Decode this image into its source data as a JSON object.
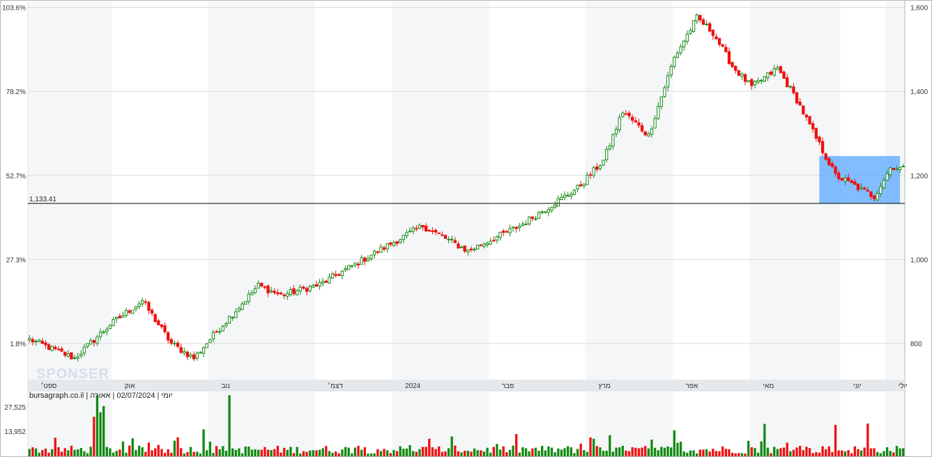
{
  "chart_data": {
    "type": "candlestick",
    "price_axis_right": {
      "ticks": [
        "1,600",
        "1,400",
        "1,200",
        "1,000",
        "800"
      ],
      "values": [
        1600,
        1400,
        1200,
        1000,
        800
      ],
      "range": [
        714,
        1614
      ]
    },
    "percent_axis_left": {
      "ticks": [
        "103.6%",
        "78.2%",
        "52.7%",
        "27.3%",
        "1.8%"
      ]
    },
    "reference_line": {
      "label": "1,133.41",
      "value": 1133.41
    },
    "months": [
      "ספט׳",
      "אוק",
      "נוב",
      "דצמ׳",
      "2024",
      "פבר",
      "מרץ",
      "אפר",
      "מאי",
      "יוני",
      "יולי"
    ],
    "highlight_range": {
      "start_index": 246,
      "end_index": 269,
      "price_low": 1134,
      "price_high": 1246
    },
    "volume_axis": {
      "ticks": [
        "27,525",
        "13,952"
      ],
      "values": [
        27525,
        13952
      ]
    },
    "key_points": [
      {
        "index": 0,
        "price": 810
      },
      {
        "index": 14,
        "price": 765
      },
      {
        "index": 25,
        "price": 845
      },
      {
        "index": 35,
        "price": 902
      },
      {
        "index": 44,
        "price": 800
      },
      {
        "index": 51,
        "price": 765
      },
      {
        "index": 58,
        "price": 828
      },
      {
        "index": 71,
        "price": 938
      },
      {
        "index": 78,
        "price": 915
      },
      {
        "index": 90,
        "price": 940
      },
      {
        "index": 108,
        "price": 1020
      },
      {
        "index": 122,
        "price": 1080
      },
      {
        "index": 136,
        "price": 1020
      },
      {
        "index": 152,
        "price": 1080
      },
      {
        "index": 170,
        "price": 1170
      },
      {
        "index": 178,
        "price": 1235
      },
      {
        "index": 184,
        "price": 1352
      },
      {
        "index": 192,
        "price": 1295
      },
      {
        "index": 200,
        "price": 1480
      },
      {
        "index": 207,
        "price": 1575
      },
      {
        "index": 212,
        "price": 1540
      },
      {
        "index": 218,
        "price": 1460
      },
      {
        "index": 224,
        "price": 1410
      },
      {
        "index": 232,
        "price": 1455
      },
      {
        "index": 238,
        "price": 1380
      },
      {
        "index": 244,
        "price": 1288
      },
      {
        "index": 250,
        "price": 1200
      },
      {
        "index": 262,
        "price": 1150
      },
      {
        "index": 267,
        "price": 1218
      }
    ],
    "volume_spikes": [
      {
        "index": 20,
        "value": 22000
      },
      {
        "index": 21,
        "value": 34000
      },
      {
        "index": 22,
        "value": 24500
      },
      {
        "index": 23,
        "value": 28000
      },
      {
        "index": 54,
        "value": 15000
      },
      {
        "index": 62,
        "value": 34000
      },
      {
        "index": 200,
        "value": 14500
      },
      {
        "index": 228,
        "value": 18000
      },
      {
        "index": 250,
        "value": 17500
      },
      {
        "index": 260,
        "value": 18200
      }
    ],
    "colors": {
      "up": "#1a8a1a",
      "down": "#ee1111",
      "highlight": "#4da3ff",
      "grid": "#dcdcdc"
    }
  },
  "info": {
    "text": "יומי | 02/07/2024 | אאורה | bursagraph.co.il",
    "watermark": "SPONSER"
  }
}
